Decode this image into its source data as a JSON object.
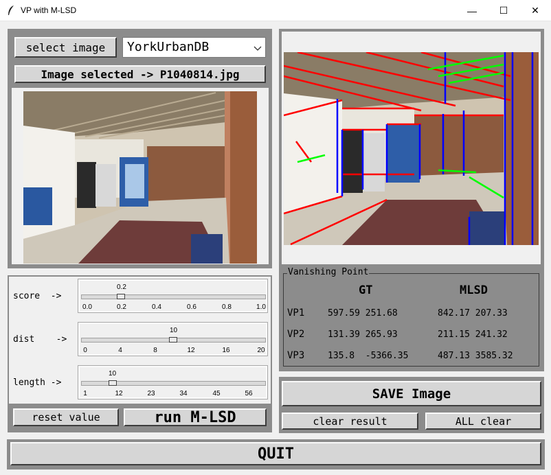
{
  "window": {
    "title": "VP with M-LSD",
    "minimize": "—",
    "maximize": "☐",
    "close": "✕"
  },
  "controls": {
    "select_image_button": "select image",
    "dataset_value": "YorkUrbanDB",
    "image_selected_label": "Image selected -> P1040814.jpg"
  },
  "sliders": [
    {
      "label": "score  ->",
      "value_text": "0.2",
      "value": 0.2,
      "min": 0.0,
      "max": 1.0,
      "ticks": [
        "0.0",
        "0.2",
        "0.4",
        "0.6",
        "0.8",
        "1.0"
      ]
    },
    {
      "label": "dist    ->",
      "value_text": "10",
      "value": 10,
      "min": 0,
      "max": 20,
      "ticks": [
        "0",
        "4",
        "8",
        "12",
        "16",
        "20"
      ]
    },
    {
      "label": "length ->",
      "value_text": "10",
      "value": 10,
      "min": 1,
      "max": 61,
      "ticks": [
        "1",
        "12",
        "23",
        "34",
        "45",
        "56"
      ]
    }
  ],
  "buttons": {
    "reset": "reset value",
    "run": "run M-LSD",
    "save": "SAVE Image",
    "clear_result": "clear result",
    "all_clear": "ALL clear",
    "quit": "QUIT"
  },
  "vanishing_point": {
    "frame_label": "Vanishing Point",
    "col_gt": "GT",
    "col_mlsd": "MLSD",
    "rows": [
      {
        "name": "VP1",
        "gt": "597.59 251.68",
        "mlsd": "842.17 207.33"
      },
      {
        "name": "VP2",
        "gt": "131.39 265.93",
        "mlsd": "211.15 241.32"
      },
      {
        "name": "VP3",
        "gt": "135.8  -5366.35",
        "mlsd": "487.13 3585.32"
      }
    ]
  },
  "colors": {
    "line_red": "#ff0000",
    "line_blue": "#0000ff",
    "line_green": "#00ff00",
    "panel_gray": "#8c8c8c"
  }
}
